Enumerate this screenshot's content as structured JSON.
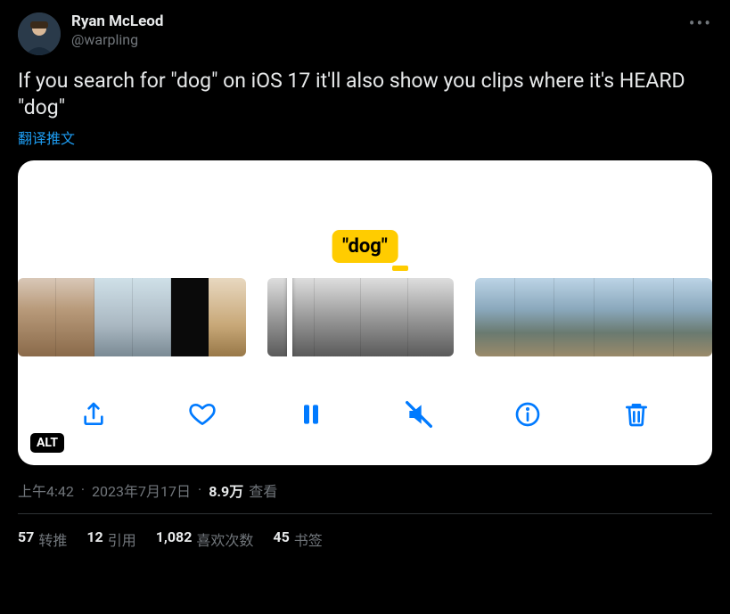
{
  "user": {
    "display_name": "Ryan McLeod",
    "handle": "@warpling"
  },
  "tweet": {
    "text": "If you search for \"dog\" on iOS 17 it'll also show you clips where it's HEARD \"dog\"",
    "translate_label": "翻译推文"
  },
  "media": {
    "highlight_label": "\"dog\"",
    "alt_badge": "ALT",
    "icons": {
      "share": "share-icon",
      "like": "heart-icon",
      "pause": "pause-icon",
      "mute": "speaker-muted-icon",
      "info": "info-icon",
      "trash": "trash-icon"
    }
  },
  "meta": {
    "time": "上午4:42",
    "date": "2023年7月17日",
    "views_num": "8.9万",
    "views_label": "查看"
  },
  "stats": {
    "retweets": {
      "num": "57",
      "label": "转推"
    },
    "quotes": {
      "num": "12",
      "label": "引用"
    },
    "likes": {
      "num": "1,082",
      "label": "喜欢次数"
    },
    "bookmarks": {
      "num": "45",
      "label": "书签"
    }
  },
  "more_label": "•••"
}
